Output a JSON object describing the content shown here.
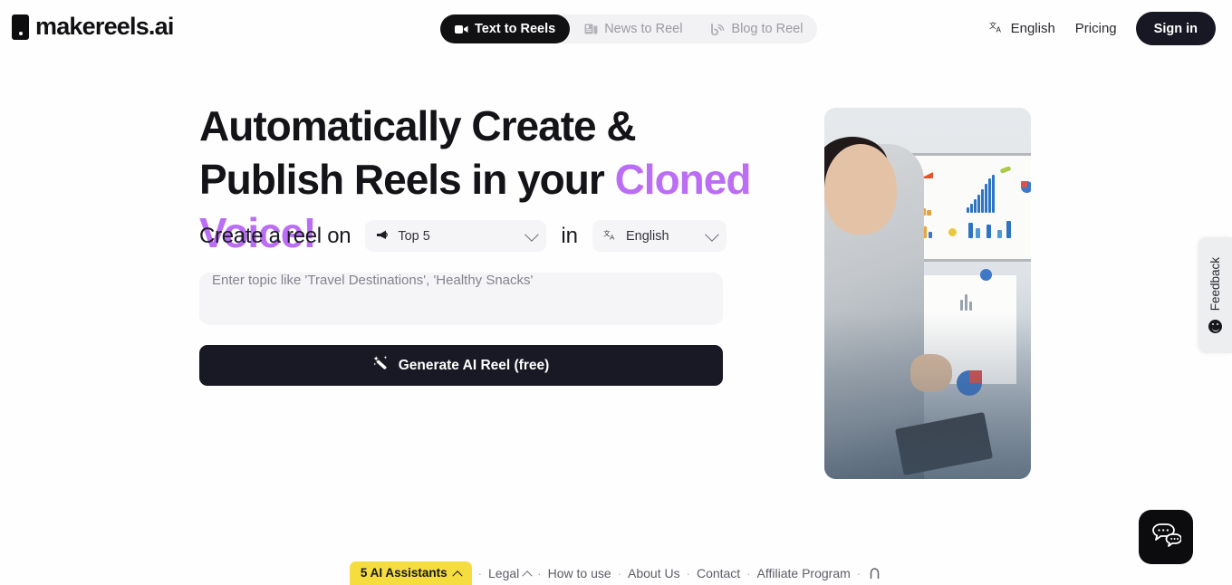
{
  "brand": {
    "name": "makereels.ai",
    "accent_color": "#bb6ef5",
    "dark_color": "#181824",
    "badge_color": "#f5dd3f"
  },
  "header": {
    "tabs": [
      {
        "label": "Text to Reels",
        "icon": "video-camera-icon",
        "active": true
      },
      {
        "label": "News to Reel",
        "icon": "newspaper-icon",
        "active": false
      },
      {
        "label": "Blog to Reel",
        "icon": "blog-rss-icon",
        "active": false
      }
    ],
    "language": {
      "label": "English",
      "icon": "translate-icon"
    },
    "pricing_label": "Pricing",
    "signin_label": "Sign in"
  },
  "hero": {
    "title_part1": "Automatically Create & Publish Reels in your ",
    "title_accent": "Cloned Voice!",
    "create_label": "Create a reel on",
    "in_label": "in",
    "topic_select": {
      "value": "Top 5",
      "icon": "megaphone-icon"
    },
    "language_select": {
      "value": "English",
      "icon": "translate-icon"
    },
    "topic_input": {
      "value": "",
      "placeholder": "Enter topic like 'Travel Destinations', 'Healthy Snacks'"
    },
    "generate_label": "Generate AI Reel (free)",
    "generate_icon": "magic-wand-icon"
  },
  "video_card": {
    "alt": "woman presenting charts on whiteboard"
  },
  "feedback": {
    "label": "Feedback",
    "icon": "smiley-icon"
  },
  "chat": {
    "icon": "chat-bubbles-icon"
  },
  "footer": {
    "assistants_badge": {
      "label": "5 AI Assistants",
      "icon": "chevron-up-icon"
    },
    "links": [
      {
        "label": "Legal",
        "icon": "chevron-up-icon"
      },
      {
        "label": "How to use",
        "icon": ""
      },
      {
        "label": "About Us",
        "icon": ""
      },
      {
        "label": "Contact",
        "icon": ""
      },
      {
        "label": "Affiliate Program",
        "icon": ""
      },
      {
        "label": "",
        "icon": "lock-icon"
      }
    ],
    "separator": "·"
  }
}
